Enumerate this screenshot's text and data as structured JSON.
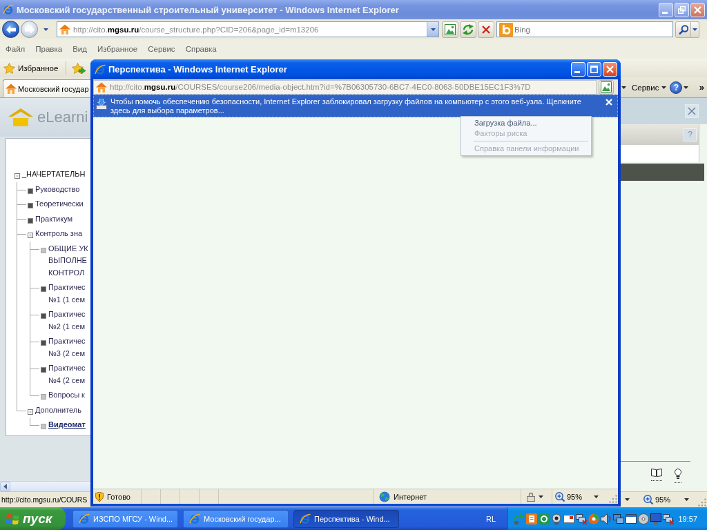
{
  "main_window": {
    "title": "Московский государственный строительный университет - Windows Internet Explorer",
    "active": false
  },
  "address_bar": {
    "url": "http://cito.**mgsu.ru**/course_structure.php?CID=206&page_id=m13206",
    "search_placeholder": "Bing"
  },
  "menu_bar": [
    "Файл",
    "Правка",
    "Вид",
    "Избранное",
    "Сервис",
    "Справка"
  ],
  "favorites_bar": {
    "label": "Избранное"
  },
  "tabs": [
    {
      "label": "Московский государ",
      "selected": true
    }
  ],
  "command_bar": {
    "tools_label": "Сервис",
    "help_glyph": "?",
    "overflow": "»"
  },
  "page": {
    "logo_text": "eLearni",
    "help_glyph": "?",
    "tree": [
      {
        "kind": "folder",
        "label": "_НАЧЕРТАТЕЛЬН",
        "expanded": true,
        "selected": false,
        "children": [
          {
            "kind": "folder",
            "label": "Руководство",
            "expanded": false,
            "selected": false
          },
          {
            "kind": "folder",
            "label": "Теоретически",
            "expanded": false,
            "selected": false
          },
          {
            "kind": "folder",
            "label": "Практикум",
            "expanded": false,
            "selected": false
          },
          {
            "kind": "folder",
            "label": "Контроль зна",
            "expanded": true,
            "selected": false,
            "children": [
              {
                "kind": "leaf",
                "label": "ОБЩИЕ УК\nВЫПОЛНЕ\nКОНТРОЛ",
                "selected": false
              },
              {
                "kind": "folder",
                "label": "Практичес\n№1 (1 сем",
                "expanded": false,
                "selected": false
              },
              {
                "kind": "folder",
                "label": "Практичес\n№2 (1 сем",
                "expanded": false,
                "selected": false
              },
              {
                "kind": "folder",
                "label": "Практичес\n№3 (2 сем",
                "expanded": false,
                "selected": false
              },
              {
                "kind": "folder",
                "label": "Практичес\n№4 (2 сем",
                "expanded": false,
                "selected": false
              },
              {
                "kind": "leaf",
                "label": "Вопросы к",
                "selected": false
              }
            ]
          },
          {
            "kind": "folder",
            "label": "Дополнитель",
            "expanded": true,
            "selected": false,
            "children": [
              {
                "kind": "leaf",
                "label": "Видеомат",
                "selected": true
              }
            ]
          }
        ]
      }
    ]
  },
  "status_bar": {
    "text": "http://cito.mgsu.ru/COURS",
    "zoom": "95%"
  },
  "popup_window": {
    "title": "Перспектива - Windows Internet Explorer",
    "active": true,
    "url": "http://cito.**mgsu.ru**/COURSES/course206/media-object.htm?id=%7B06305730-6BC7-4EC0-8063-50DBE15EC1F3%7D",
    "info_bar": {
      "text": "Чтобы помочь обеспечению безопасности, Internet Explorer заблокировал загрузку файлов на компьютер с этого веб-узла. Щелкните здесь для выбора параметров..."
    },
    "info_menu": [
      {
        "kind": "item",
        "label": "Загрузка файла...",
        "disabled": false
      },
      {
        "kind": "item",
        "label": "Факторы риска",
        "disabled": true
      },
      {
        "kind": "separator"
      },
      {
        "kind": "item",
        "label": "Справка панели информации",
        "disabled": true
      }
    ],
    "status_bar": {
      "text": "Готово",
      "zone": "Интернет",
      "zoom": "95%"
    }
  },
  "taskbar": {
    "start_label": "пуск",
    "buttons": [
      {
        "label": "ИЗСПО МГСУ - Wind...",
        "selected": false
      },
      {
        "label": "Московский государ...",
        "selected": false
      },
      {
        "label": "Перспектива - Wind...",
        "selected": true
      }
    ],
    "language": "RL",
    "clock": "19:57"
  }
}
